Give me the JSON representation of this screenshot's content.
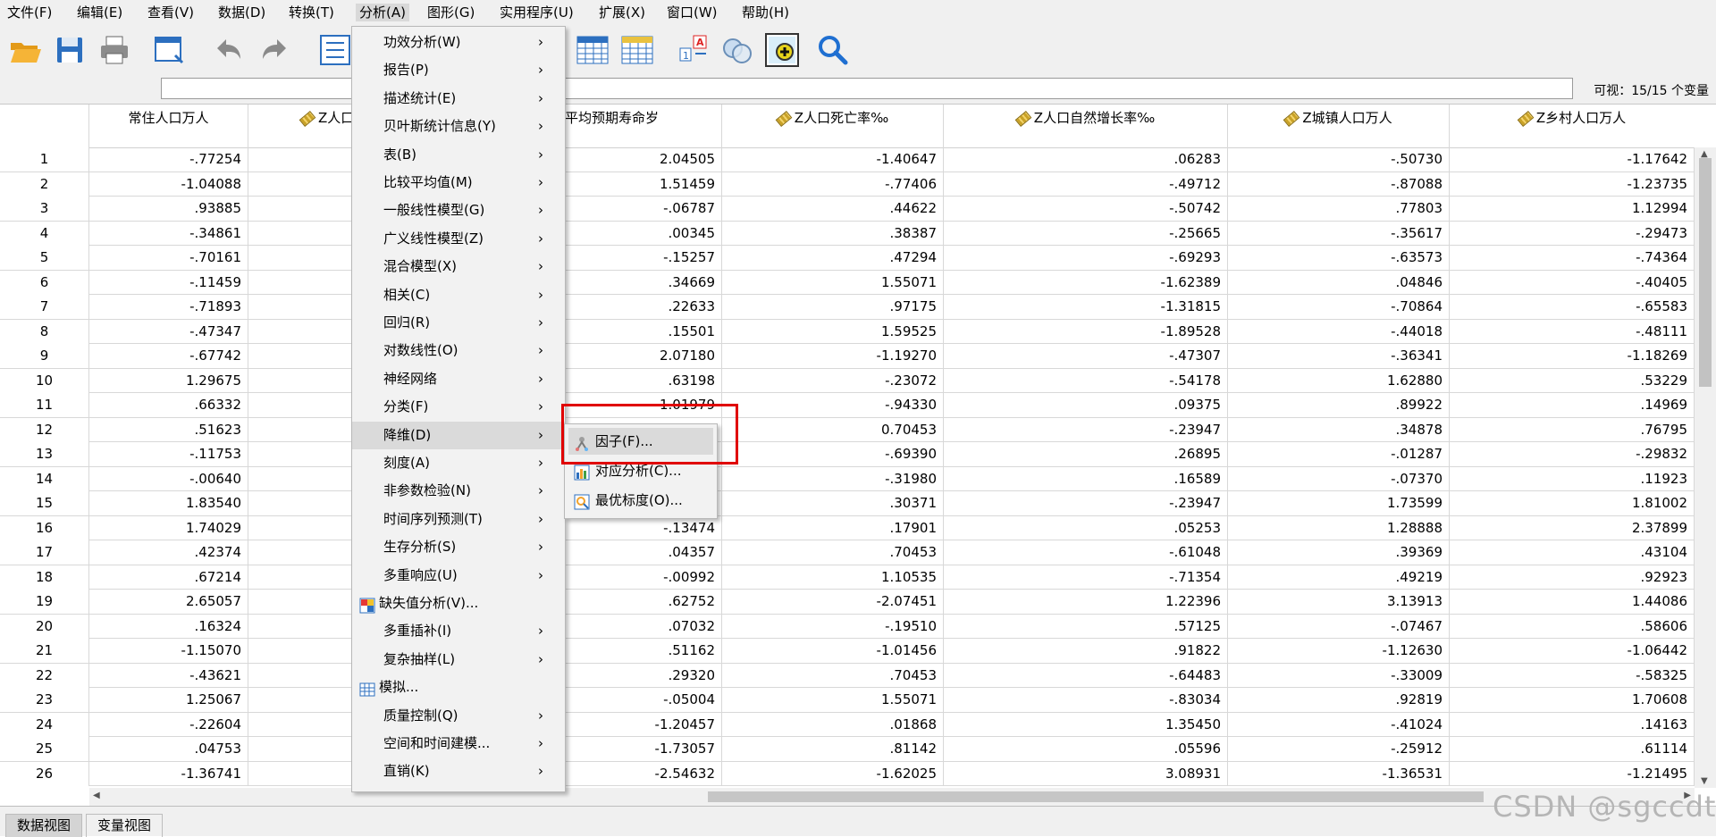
{
  "menubar": {
    "items": [
      "文件(F)",
      "编辑(E)",
      "查看(V)",
      "数据(D)",
      "转换(T)",
      "分析(A)",
      "图形(G)",
      "实用程序(U)",
      "扩展(X)",
      "窗口(W)",
      "帮助(H)"
    ],
    "active": "分析(A)"
  },
  "toolbar": {
    "icons": [
      "open-folder-icon",
      "save-icon",
      "print-icon",
      "dialog-recall-icon",
      "undo-icon",
      "redo-icon",
      "goto-case-icon",
      "goto-variable-icon",
      "variables-icon",
      "insert-case-icon",
      "split-file-icon",
      "weight-cases-icon",
      "select-cases-icon",
      "value-labels-icon",
      "use-sets-icon",
      "find-icon"
    ]
  },
  "status": {
    "visible_vars": "可视：15/15 个变量"
  },
  "grid": {
    "headers": [
      "常住人口万人",
      "Z人口",
      "平均预期寿命岁",
      "Z人口死亡率‰",
      "Z人口自然增长率‰",
      "Z城镇人口万人",
      "Z乡村人口万人"
    ],
    "rows": [
      [
        "1",
        "-.77254",
        "2.04505",
        "-1.40647",
        ".06283",
        "-.50730",
        "-1.17642"
      ],
      [
        "2",
        "-1.04088",
        "1.51459",
        "-.77406",
        "-.49712",
        "-.87088",
        "-1.23735"
      ],
      [
        "3",
        ".93885",
        "-.06787",
        ".44622",
        "-.50742",
        ".77803",
        "1.12994"
      ],
      [
        "4",
        "-.34861",
        ".00345",
        ".38387",
        "-.25665",
        "-.35617",
        "-.29473"
      ],
      [
        "5",
        "-.70161",
        "-.15257",
        ".47294",
        "-.69293",
        "-.63573",
        "-.74364"
      ],
      [
        "6",
        "-.11459",
        ".34669",
        "1.55071",
        "-1.62389",
        ".04846",
        "-.40405"
      ],
      [
        "7",
        "-.71893",
        ".22633",
        ".97175",
        "-1.31815",
        "-.70864",
        "-.65583"
      ],
      [
        "8",
        "-.47347",
        ".15501",
        "1.59525",
        "-1.89528",
        "-.44018",
        "-.48111"
      ],
      [
        "9",
        "-.67742",
        "2.07180",
        "-1.19270",
        "-.47307",
        "-.36341",
        "-1.18269"
      ],
      [
        "10",
        "1.29675",
        ".63198",
        "-.23072",
        "-.54178",
        "1.62880",
        ".53229"
      ],
      [
        "11",
        ".66332",
        "1.01979",
        "-.94330",
        ".09375",
        ".89922",
        ".14969"
      ],
      [
        "12",
        ".51623",
        "",
        "0.70453",
        "-.23947",
        ".34878",
        ".76795"
      ],
      [
        "13",
        "-.11753",
        "",
        "-.69390",
        ".26895",
        "-.01287",
        "-.29832"
      ],
      [
        "14",
        "-.00640",
        "",
        "-.31980",
        ".16589",
        "-.07370",
        ".11923"
      ],
      [
        "15",
        "1.83540",
        "",
        ".30371",
        "-.23947",
        "1.73599",
        "1.81002"
      ],
      [
        "16",
        "1.74029",
        "-.13474",
        ".17901",
        ".05253",
        "1.28888",
        "2.37899"
      ],
      [
        "17",
        ".42374",
        ".04357",
        ".70453",
        "-.61048",
        ".39369",
        ".43104"
      ],
      [
        "18",
        ".67214",
        "-.00992",
        "1.10535",
        "-.71354",
        ".49219",
        ".92923"
      ],
      [
        "19",
        "2.65057",
        ".62752",
        "-2.07451",
        "1.22396",
        "3.13913",
        "1.44086"
      ],
      [
        "20",
        ".16324",
        ".07032",
        "-.19510",
        ".57125",
        "-.07467",
        ".58606"
      ],
      [
        "21",
        "-1.15070",
        ".51162",
        "-1.01456",
        ".91822",
        "-1.12630",
        "-1.06442"
      ],
      [
        "22",
        "-.43621",
        ".29320",
        ".70453",
        "-.64483",
        "-.33009",
        "-.58325"
      ],
      [
        "23",
        "1.25067",
        "-.05004",
        "1.55071",
        "-.83034",
        ".92819",
        "1.70608"
      ],
      [
        "24",
        "-.22604",
        "-1.20457",
        ".01868",
        "1.35450",
        "-.41024",
        ".14163"
      ],
      [
        "25",
        ".04753",
        "-1.73057",
        ".81142",
        ".05596",
        "-.25912",
        ".61114"
      ],
      [
        "26",
        "-1.36741",
        "-2.54632",
        "-1.62025",
        "3.08931",
        "-1.36531",
        "-1.21495"
      ]
    ]
  },
  "analyze_menu": {
    "items": [
      {
        "label": "功效分析(W)",
        "sub": true,
        "icon": ""
      },
      {
        "label": "报告(P)",
        "sub": true,
        "icon": ""
      },
      {
        "label": "描述统计(E)",
        "sub": true,
        "icon": ""
      },
      {
        "label": "贝叶斯统计信息(Y)",
        "sub": true,
        "icon": ""
      },
      {
        "label": "表(B)",
        "sub": true,
        "icon": ""
      },
      {
        "label": "比较平均值(M)",
        "sub": true,
        "icon": ""
      },
      {
        "label": "一般线性模型(G)",
        "sub": true,
        "icon": ""
      },
      {
        "label": "广义线性模型(Z)",
        "sub": true,
        "icon": ""
      },
      {
        "label": "混合模型(X)",
        "sub": true,
        "icon": ""
      },
      {
        "label": "相关(C)",
        "sub": true,
        "icon": ""
      },
      {
        "label": "回归(R)",
        "sub": true,
        "icon": ""
      },
      {
        "label": "对数线性(O)",
        "sub": true,
        "icon": ""
      },
      {
        "label": "神经网络",
        "sub": true,
        "icon": ""
      },
      {
        "label": "分类(F)",
        "sub": true,
        "icon": ""
      },
      {
        "label": "降维(D)",
        "sub": true,
        "icon": ""
      },
      {
        "label": "刻度(A)",
        "sub": true,
        "icon": ""
      },
      {
        "label": "非参数检验(N)",
        "sub": true,
        "icon": ""
      },
      {
        "label": "时间序列预测(T)",
        "sub": true,
        "icon": ""
      },
      {
        "label": "生存分析(S)",
        "sub": true,
        "icon": ""
      },
      {
        "label": "多重响应(U)",
        "sub": true,
        "icon": ""
      },
      {
        "label": "缺失值分析(V)...",
        "sub": false,
        "icon": "missing-value-icon"
      },
      {
        "label": "多重插补(I)",
        "sub": true,
        "icon": ""
      },
      {
        "label": "复杂抽样(L)",
        "sub": true,
        "icon": ""
      },
      {
        "label": "模拟...",
        "sub": false,
        "icon": "simulation-icon"
      },
      {
        "label": "质量控制(Q)",
        "sub": true,
        "icon": ""
      },
      {
        "label": "空间和时间建模...",
        "sub": true,
        "icon": ""
      },
      {
        "label": "直销(K)",
        "sub": true,
        "icon": ""
      }
    ],
    "highlighted": "降维(D)"
  },
  "dimension_submenu": {
    "items": [
      {
        "label": "因子(F)...",
        "icon": "factor-icon"
      },
      {
        "label": "对应分析(C)...",
        "icon": "correspondence-icon"
      },
      {
        "label": "最优标度(O)...",
        "icon": "optimal-scaling-icon"
      }
    ],
    "highlighted": "因子(F)..."
  },
  "tabs": [
    "数据视图",
    "变量视图"
  ],
  "watermark": "CSDN @sgccdt"
}
